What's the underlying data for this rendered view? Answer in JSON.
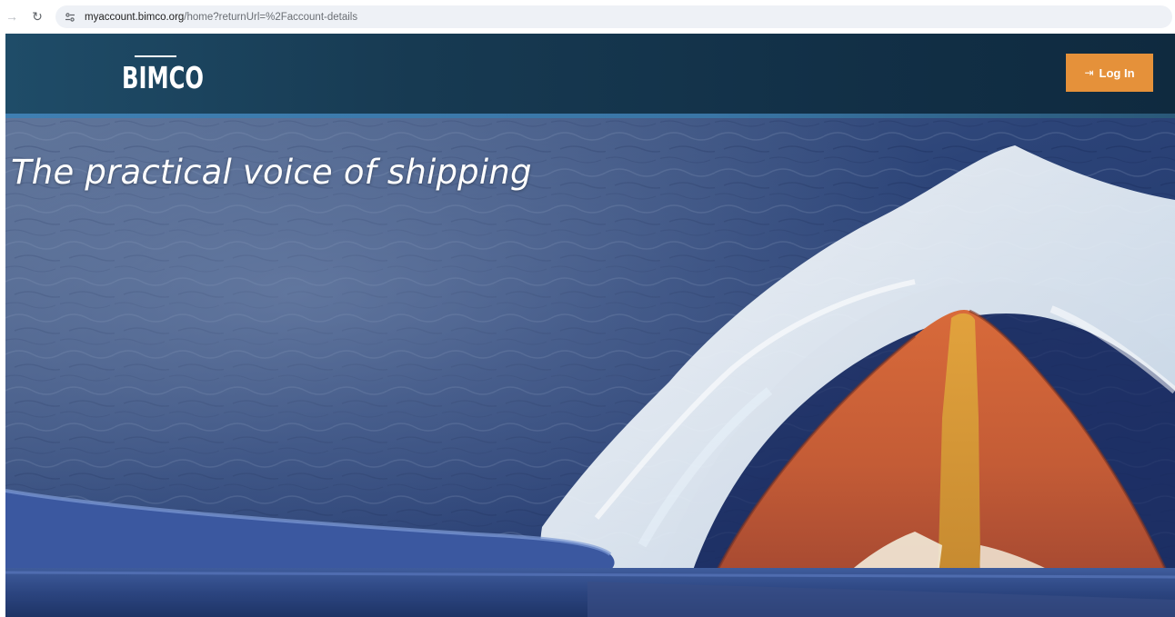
{
  "browser": {
    "url_host": "myaccount.bimco.org",
    "url_path": "/home?returnUrl=%2Faccount-details",
    "back_icon": "arrow-right-icon",
    "reload_icon": "reload-icon",
    "site_info_icon": "tune-icon"
  },
  "header": {
    "logo_text": "BIMCO",
    "login_label": "Log In",
    "login_icon": "sign-in-icon",
    "colors": {
      "header_bg": "#173a52",
      "stripe": "#3f7fb2",
      "login_bg": "#e5913a"
    }
  },
  "hero": {
    "tagline": "The practical voice of shipping"
  }
}
